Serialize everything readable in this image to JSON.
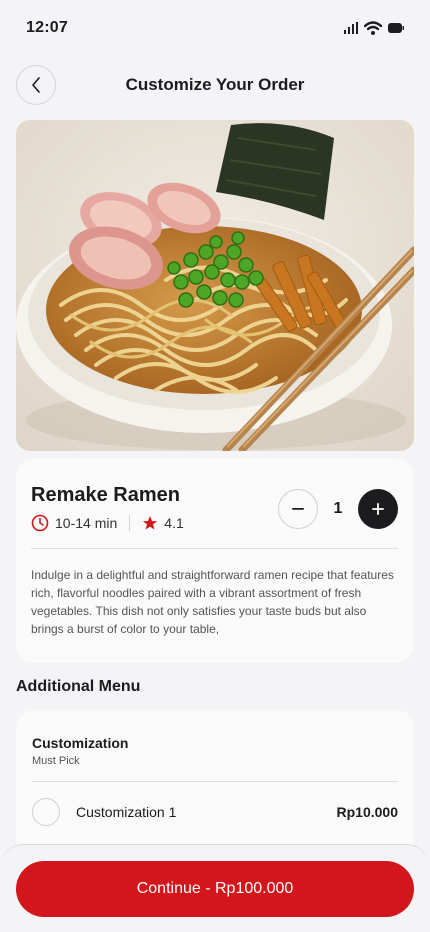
{
  "status_bar": {
    "time": "12:07"
  },
  "header": {
    "title": "Customize Your Order"
  },
  "product": {
    "name": "Remake Ramen",
    "duration": "10-14 min",
    "rating": "4.1",
    "quantity": "1",
    "description": "Indulge in a delightful and straightforward ramen recipe that features rich, flavorful noodles paired with a vibrant assortment of fresh vegetables. This dish not only satisfies your taste buds but also brings a burst of color to your table,"
  },
  "additional_menu": {
    "title": "Additional Menu",
    "group_title": "Customization",
    "group_subtitle": "Must Pick",
    "options": [
      {
        "label": "Customization 1",
        "price": "Rp10.000"
      }
    ]
  },
  "footer": {
    "button_label": "Continue - Rp100.000"
  },
  "colors": {
    "accent": "#d3151c",
    "dark": "#1c1c1e",
    "background": "#f4f4f6"
  },
  "icons": [
    "signal-icon",
    "wifi-icon",
    "battery-icon",
    "back-arrow-icon",
    "clock-icon",
    "star-icon",
    "minus-icon",
    "plus-icon"
  ]
}
